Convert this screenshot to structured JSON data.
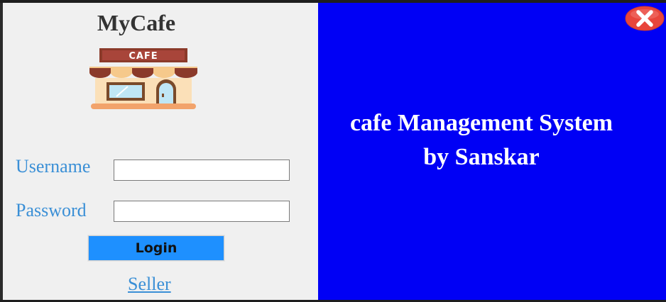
{
  "app": {
    "title": "MyCafe",
    "logo_sign": "CAFE"
  },
  "login_form": {
    "username_label": "Username",
    "username_value": "",
    "password_label": "Password",
    "password_value": "",
    "login_button": "Login",
    "seller_link": "Seller"
  },
  "banner": {
    "line1": "cafe Management System",
    "line2": "by Sanskar"
  },
  "icons": {
    "logo": "cafe-storefront-icon",
    "close": "close-icon"
  },
  "colors": {
    "banner_background": "#0000f5",
    "label_color": "#3a8fd6",
    "login_button": "#1e90ff",
    "close_button": "#e8453c"
  }
}
